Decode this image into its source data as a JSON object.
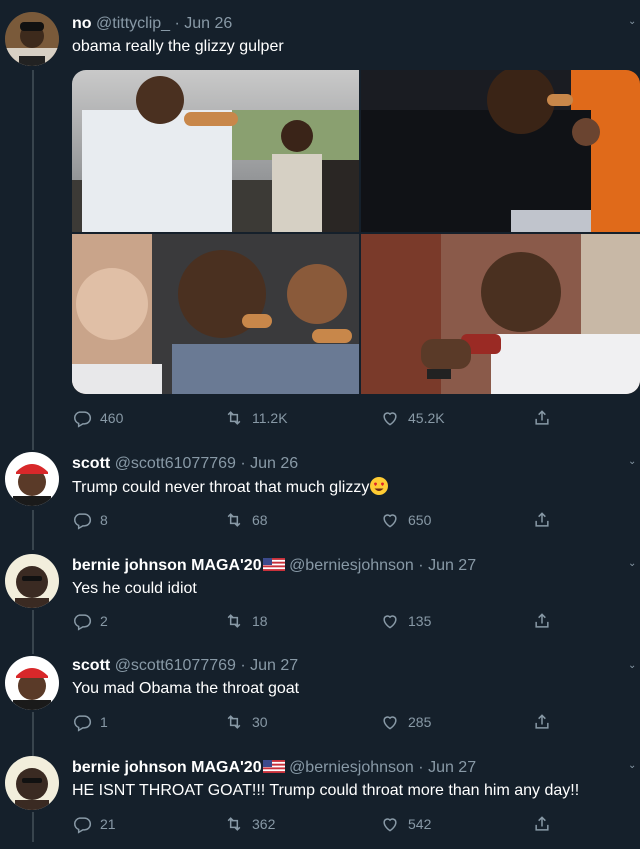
{
  "tweets": [
    {
      "name": "no",
      "handle": "@tittyclip_",
      "sep": "·",
      "date": "Jun 26",
      "text": "obama really the glizzy gulper",
      "replies": "460",
      "retweets": "11.2K",
      "likes": "45.2K"
    },
    {
      "name": "scott",
      "handle": "@scott61077769",
      "sep": "·",
      "date": "Jun 26",
      "text": "Trump could never throat that much glizzy",
      "replies": "8",
      "retweets": "68",
      "likes": "650"
    },
    {
      "name": "bernie johnson MAGA'20",
      "handle": "@berniesjohnson",
      "sep": "·",
      "date": "Jun 27",
      "text": "Yes he could idiot",
      "replies": "2",
      "retweets": "18",
      "likes": "135"
    },
    {
      "name": "scott",
      "handle": "@scott61077769",
      "sep": "·",
      "date": "Jun 27",
      "text": "You mad Obama the throat goat",
      "replies": "1",
      "retweets": "30",
      "likes": "285"
    },
    {
      "name": "bernie johnson MAGA'20",
      "handle": "@berniesjohnson",
      "sep": "·",
      "date": "Jun 27",
      "text": "HE ISNT THROAT GOAT!!! Trump could throat more than him any day!!",
      "replies": "21",
      "retweets": "362",
      "likes": "542"
    }
  ],
  "colors": {
    "background": "#15202b",
    "muted": "#8899a6",
    "thread_line": "#38444d"
  },
  "icons": [
    "reply-icon",
    "retweet-icon",
    "like-icon",
    "share-icon",
    "us-flag-icon",
    "heart-eyes-emoji"
  ]
}
